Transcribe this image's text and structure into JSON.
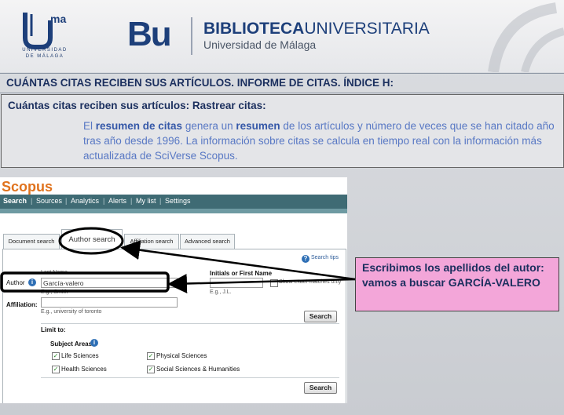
{
  "header": {
    "uma_short": "ma",
    "uma_name_line1": "UNIVERSIDAD",
    "uma_name_line2": "DE MÁLAGA",
    "bu_mark": "Bu",
    "title_bold": "BIBLIOTECA",
    "title_rest": "UNIVERSITARIA",
    "subtitle": "Universidad de Málaga"
  },
  "slide": {
    "heading": "CUÁNTAS CITAS RECIBEN SUS ARTÍCULOS. INFORME DE CITAS. ÍNDICE H:",
    "box_title": "Cuántas citas reciben sus artículos: Rastrear citas:",
    "text_p1": "El ",
    "text_b1": "resumen de citas",
    "text_p2": " genera un ",
    "text_b2": "resumen",
    "text_p3": " de los artículos y número de veces que se han citado año tras año desde 1996. La información sobre citas se calcula en tiempo real con la información más actualizada de SciVerse Scopus."
  },
  "scopus": {
    "logo": "Scopus",
    "nav": [
      "Search",
      "Sources",
      "Analytics",
      "Alerts",
      "My list",
      "Settings"
    ],
    "tabs": [
      "Document search",
      "Author search",
      "Affiliation search",
      "Advanced search"
    ],
    "search_tips": "Search tips",
    "author_label": "Author",
    "last_name_label": "Last Name",
    "last_name_value": "García-valero",
    "last_name_example": "E.g., Smith",
    "initials_label": "Initials or First Name",
    "initials_example": "E.g., J.L.",
    "exact_match": "Show exact matches only",
    "affiliation_label": "Affiliation:",
    "affiliation_example": "E.g., university of toronto",
    "search_button": "Search",
    "limit_to": "Limit to:",
    "subject_areas": "Subject Areas",
    "subjects": [
      "Life Sciences",
      "Physical Sciences",
      "Health Sciences",
      "Social Sciences & Humanities"
    ]
  },
  "callout": {
    "text": "Escribimos los apellidos del autor: vamos a buscar GARCÍA-VALERO"
  },
  "colors": {
    "heading_text": "#1b2f5e",
    "body_text": "#5878c4",
    "callout_bg": "#f3a6d9",
    "scopus_nav": "#3f6b74",
    "scopus_logo": "#e0731e"
  }
}
